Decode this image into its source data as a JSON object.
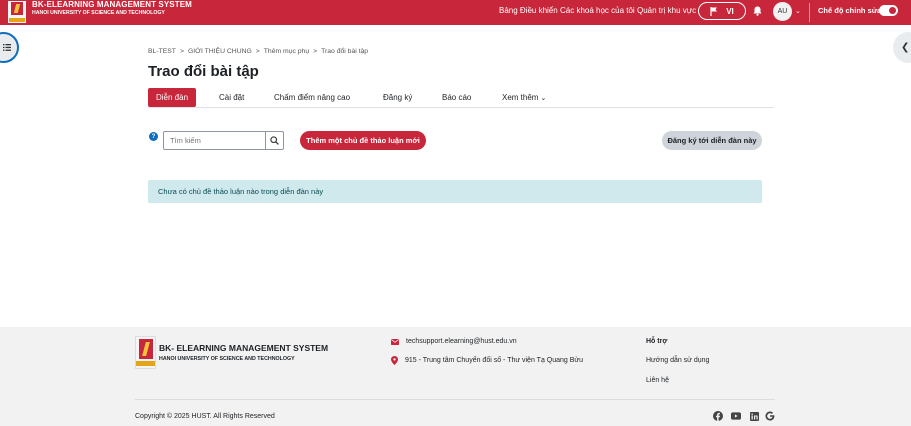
{
  "header": {
    "brand_title": "BK-ELEARNING MANAGEMENT SYSTEM",
    "brand_subtitle": "HANOI UNIVERSITY OF SCIENCE AND TECHNOLOGY",
    "nav": [
      "Bảng Điều khiển",
      "Các khoá học của tôi",
      "Quản trị khu vực"
    ],
    "language": "VI",
    "avatar_initials": "AU",
    "edit_mode_label": "Chế độ chỉnh sửa",
    "edit_mode_on": true
  },
  "breadcrumb": [
    "BL-TEST",
    "GIỚI THIỆU CHUNG",
    "Thêm mục phụ",
    "Trao đổi bài tập"
  ],
  "page_title": "Trao đổi bài tập",
  "tabs": [
    "Diễn đàn",
    "Cài đặt",
    "Chấm điểm nâng cao",
    "Đăng ký",
    "Báo cáo",
    "Xem thêm"
  ],
  "active_tab": "Diễn đàn",
  "search": {
    "placeholder": "Tìm kiếm"
  },
  "actions": {
    "add_discussion": "Thêm một chủ đề thảo luận mới",
    "subscribe": "Đăng ký tới diễn đàn này"
  },
  "alert_text": "Chưa có chủ đề thảo luận nào trong diễn đàn này",
  "footer": {
    "brand_title": "BK- ELEARNING MANAGEMENT SYSTEM",
    "brand_subtitle": "HANOI UNIVERSITY OF SCIENCE AND TECHNOLOGY",
    "email": "techsupport.elearning@hust.edu.vn",
    "address": "915 - Trung tâm Chuyển đổi số - Thư viện Tạ Quang Bửu",
    "support_title": "Hỗ trợ",
    "support_links": [
      "Hướng dẫn sử dụng",
      "Liên hệ"
    ],
    "copyright": "Copyright © 2025 HUST. All Rights Reserved",
    "social_icons": [
      "facebook-icon",
      "youtube-icon",
      "linkedin-icon",
      "google-icon"
    ]
  },
  "colors": {
    "brand": "#c8263a",
    "alert_bg": "#cfe9ec",
    "footer_bg": "#f2f2f2"
  }
}
